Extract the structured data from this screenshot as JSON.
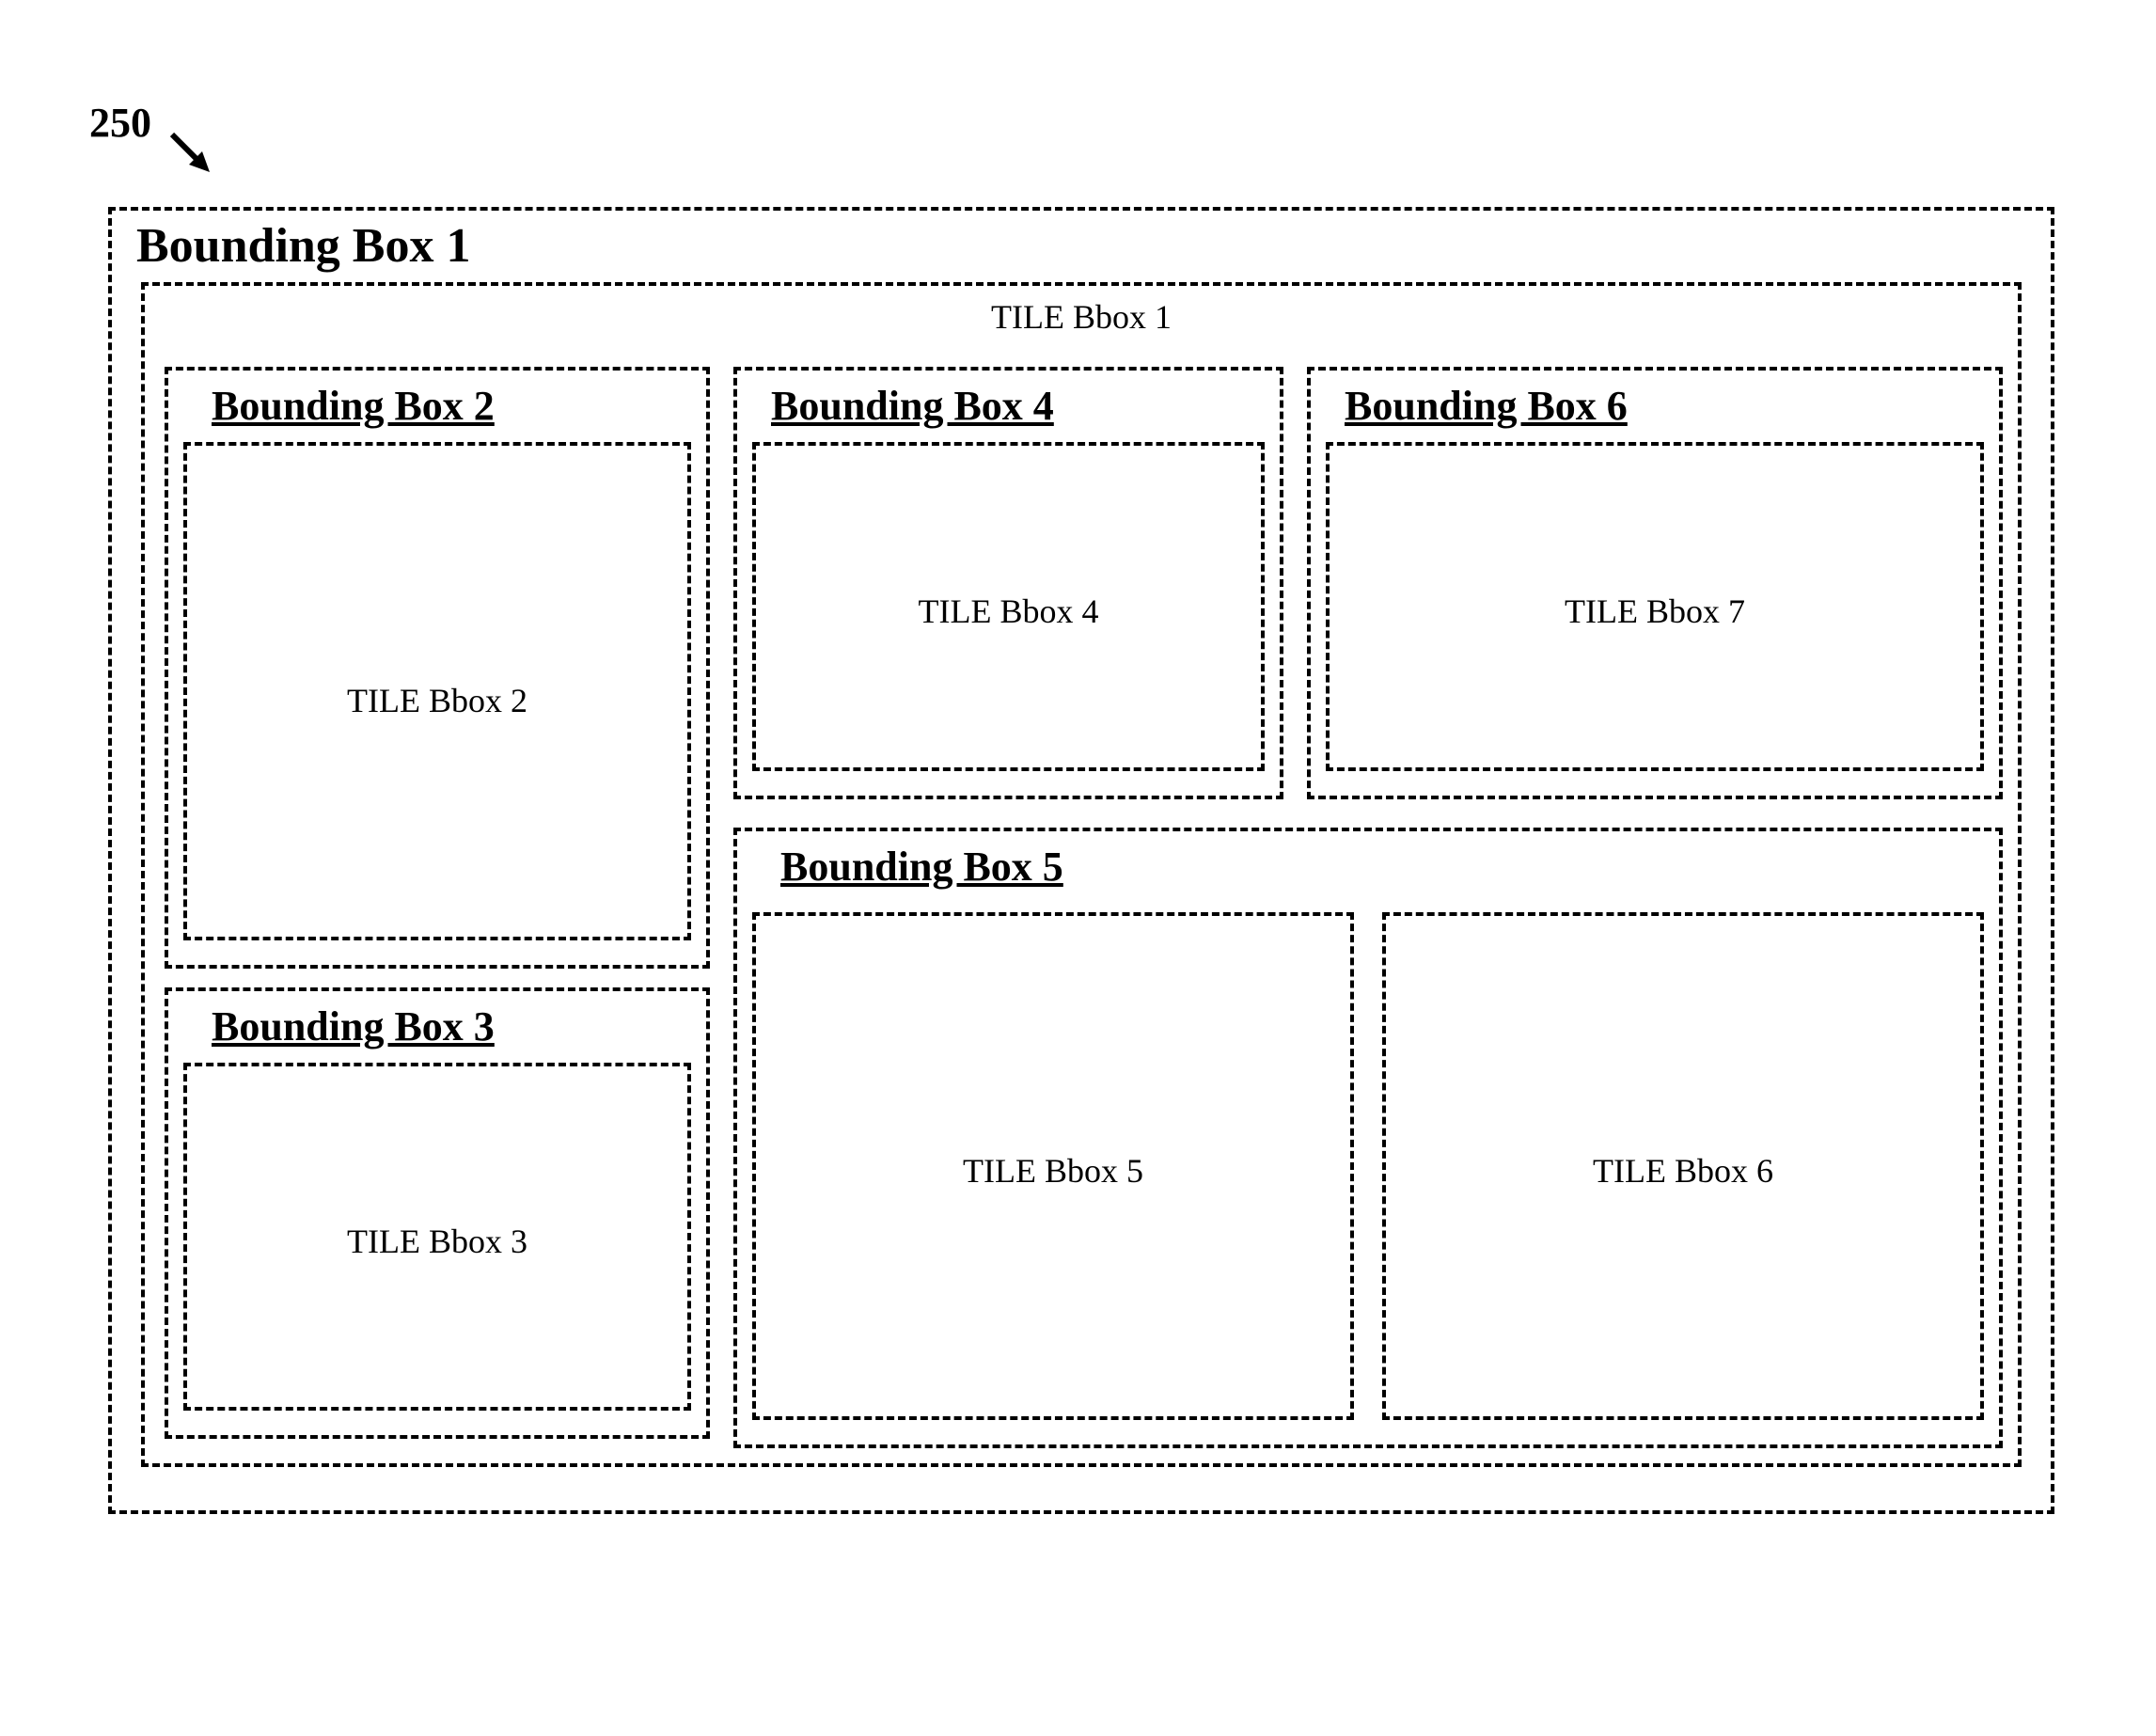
{
  "figure_number": "250",
  "boxes": {
    "bb1": {
      "title": "Bounding Box 1",
      "tile": "TILE Bbox 1"
    },
    "bb2": {
      "title": "Bounding Box 2",
      "tile": "TILE Bbox 2"
    },
    "bb3": {
      "title": "Bounding Box 3",
      "tile": "TILE Bbox 3"
    },
    "bb4": {
      "title": "Bounding Box 4",
      "tile": "TILE Bbox 4"
    },
    "bb5": {
      "title": "Bounding Box 5",
      "tile5": "TILE Bbox 5",
      "tile6": "TILE Bbox 6"
    },
    "bb6": {
      "title": "Bounding Box 6",
      "tile": "TILE Bbox 7"
    }
  }
}
